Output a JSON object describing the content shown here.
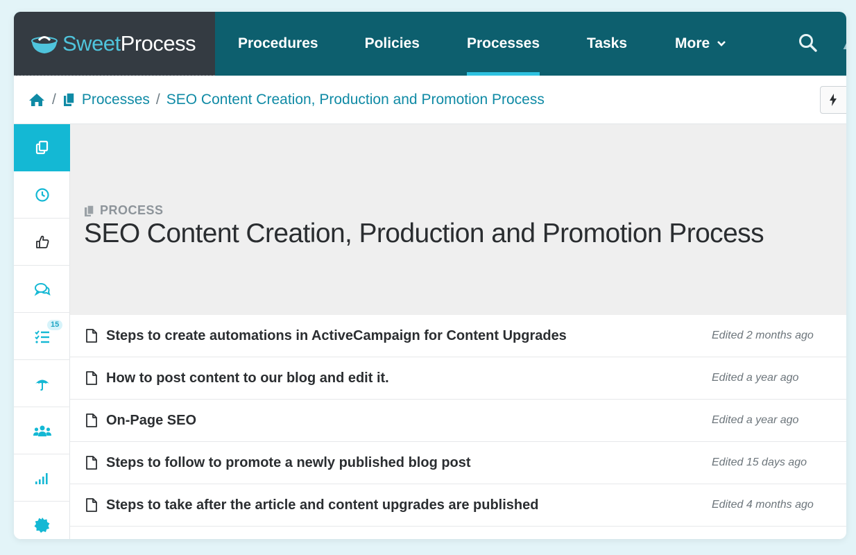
{
  "brand": {
    "name_part1": "Sweet",
    "name_part2": "Process"
  },
  "nav": {
    "items": [
      {
        "label": "Procedures"
      },
      {
        "label": "Policies"
      },
      {
        "label": "Processes",
        "active": true
      },
      {
        "label": "Tasks"
      },
      {
        "label": "More"
      }
    ]
  },
  "breadcrumb": {
    "processes": "Processes",
    "current": "SEO Content Creation, Production and Promotion Process"
  },
  "sidebar": {
    "items": [
      {
        "icon": "copy-icon"
      },
      {
        "icon": "clock-icon"
      },
      {
        "icon": "thumbs-up-icon"
      },
      {
        "icon": "comments-icon"
      },
      {
        "icon": "tasks-icon",
        "badge": "15"
      },
      {
        "icon": "umbrella-icon"
      },
      {
        "icon": "users-icon"
      },
      {
        "icon": "signal-icon"
      },
      {
        "icon": "badge-icon"
      }
    ]
  },
  "header": {
    "type_label": "PROCESS",
    "title": "SEO Content Creation, Production and Promotion Process"
  },
  "procedures": [
    {
      "title": "Steps to create automations in ActiveCampaign for Content Upgrades",
      "edited": "Edited 2 months ago"
    },
    {
      "title": "How to post content to our blog and edit it.",
      "edited": "Edited a year ago"
    },
    {
      "title": "On-Page SEO",
      "edited": "Edited a year ago"
    },
    {
      "title": "Steps to follow to promote a newly published blog post",
      "edited": "Edited 15 days ago"
    },
    {
      "title": "Steps to take after the article and content upgrades are published",
      "edited": "Edited 4 months ago"
    }
  ],
  "colors": {
    "nav_bg": "#0d5f6e",
    "logo_bg": "#343b42",
    "accent": "#14b8d4",
    "link": "#0f8aa5"
  }
}
